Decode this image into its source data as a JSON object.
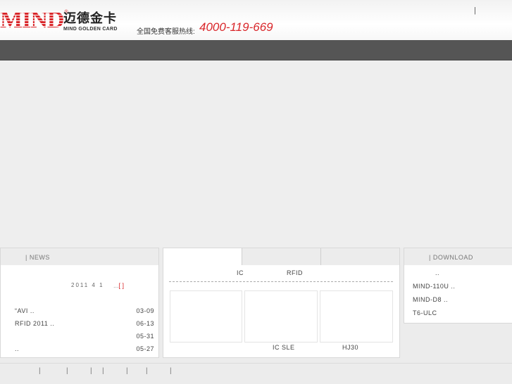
{
  "header": {
    "logo_mind": "MIND",
    "logo_reg": "®",
    "logo_cn": "迈德金卡",
    "logo_en": "MIND GOLDEN CARD",
    "hotline_label": "全国免费客服热线:",
    "hotline_number": "4000-119-669",
    "top_separator": "|"
  },
  "news": {
    "title": "| NEWS",
    "top_date": "2011 4 1",
    "more_dots": "...",
    "more_link": "[ ]",
    "items": [
      {
        "text": "“AVI        ..",
        "date": "03-09"
      },
      {
        "text": "RFID    2011      ..",
        "date": "06-13"
      },
      {
        "text": "",
        "date": "05-31"
      },
      {
        "text": "           ..",
        "date": "05-27"
      }
    ]
  },
  "products": {
    "categories": [
      "IC",
      "RFID"
    ],
    "names": [
      "IC SLE",
      "HJ30"
    ]
  },
  "download": {
    "title": "| DOWNLOAD",
    "items": [
      "..",
      "MIND-110U      ..",
      "MIND-D8       ..",
      "T6-ULC"
    ]
  },
  "footer": {
    "separators": [
      "|",
      "|",
      "|",
      "|",
      "|",
      "|",
      "|"
    ]
  }
}
